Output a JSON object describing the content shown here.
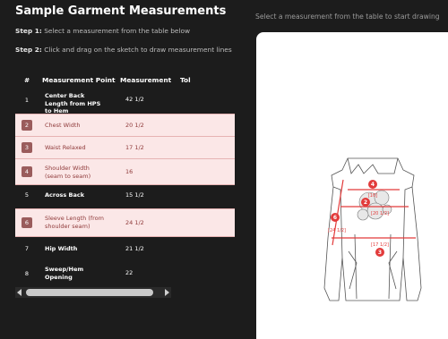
{
  "title": "Sample Garment Measurements",
  "step1": {
    "label": "Step 1:",
    "text": " Select a measurement from the table below"
  },
  "step2": {
    "label": "Step 2:",
    "text": " Click and drag on the sketch to draw measurement lines"
  },
  "table": {
    "headers": [
      "#",
      "Measurement Point",
      "Measurement",
      "Tol"
    ],
    "rows": [
      {
        "num": "1",
        "point": "Center Back Length from HPS to Hem",
        "measurement": "42 1/2",
        "selected": false
      },
      {
        "num": "2",
        "point": "Chest Width",
        "measurement": "20 1/2",
        "selected": true
      },
      {
        "num": "3",
        "point": "Waist Relaxed",
        "measurement": "17 1/2",
        "selected": true
      },
      {
        "num": "4",
        "point": "Shoulder Width (seam to seam)",
        "measurement": "16",
        "selected": true
      },
      {
        "num": "5",
        "point": "Across Back",
        "measurement": "15 1/2",
        "selected": false
      },
      {
        "num": "6",
        "point": "Sleeve Length (from shoulder seam)",
        "measurement": "24 1/2",
        "selected": true
      },
      {
        "num": "7",
        "point": "Hip Width",
        "measurement": "21 1/2",
        "selected": false
      },
      {
        "num": "8",
        "point": "Sweep/Hem Opening",
        "measurement": "22",
        "selected": false
      }
    ]
  },
  "canvas_hint": "Select a measurement from the table to start drawing",
  "sketch": {
    "markers": [
      "4",
      "2",
      "3",
      "6"
    ],
    "labels": [
      "[16]",
      "[20 1/2]",
      "[24 1/2]",
      "[17 1/2]"
    ]
  },
  "colors": {
    "accent": "#e23b3b",
    "selected_row_bg": "#fbe7e7",
    "selected_text": "#8f3a3a",
    "badge": "#9a5c5c"
  }
}
